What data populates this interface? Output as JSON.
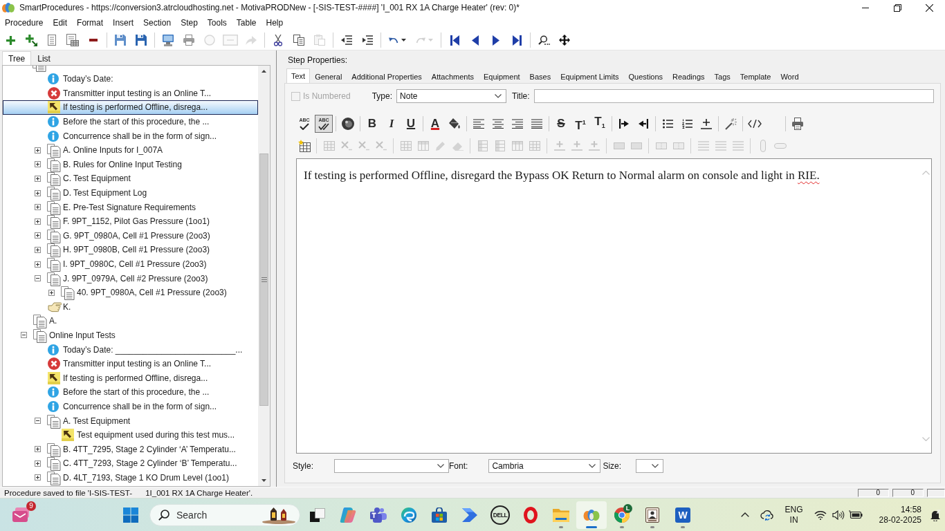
{
  "window": {
    "title": "SmartProcedures - https://conversion3.atrcloudhosting.net - MotivaPRODNew - [-SIS-TEST-####] 'I_001 RX 1A Charge Heater' (rev: 0)*"
  },
  "menu": [
    "Procedure",
    "Edit",
    "Format",
    "Insert",
    "Section",
    "Step",
    "Tools",
    "Table",
    "Help"
  ],
  "toolbar": [
    [
      {
        "kind": "add",
        "disabled": false
      },
      {
        "kind": "addchild",
        "disabled": false
      },
      {
        "kind": "list",
        "disabled": false
      },
      {
        "kind": "listtable",
        "disabled": false
      },
      {
        "kind": "remove",
        "disabled": false
      }
    ],
    [
      {
        "kind": "saveall",
        "disabled": false
      },
      {
        "kind": "save",
        "disabled": false
      }
    ],
    [
      {
        "kind": "publish",
        "disabled": false
      },
      {
        "kind": "print",
        "disabled": false
      },
      {
        "kind": "circle",
        "disabled": true
      },
      {
        "kind": "frame",
        "disabled": true
      },
      {
        "kind": "forward",
        "disabled": true
      }
    ],
    [
      {
        "kind": "cut",
        "disabled": false
      },
      {
        "kind": "copy",
        "disabled": false
      },
      {
        "kind": "paste",
        "disabled": true
      }
    ],
    [
      {
        "kind": "outdent",
        "disabled": false
      },
      {
        "kind": "indent",
        "disabled": false
      }
    ],
    [
      {
        "kind": "undo",
        "disabled": false
      },
      {
        "kind": "redo",
        "disabled": true
      }
    ],
    [
      {
        "kind": "first",
        "disabled": false
      },
      {
        "kind": "previous",
        "disabled": false
      },
      {
        "kind": "next",
        "disabled": false
      },
      {
        "kind": "last",
        "disabled": false
      }
    ],
    [
      {
        "kind": "find",
        "disabled": false
      },
      {
        "kind": "move",
        "disabled": false
      }
    ]
  ],
  "left_tabs": [
    {
      "label": "Tree",
      "selected": true
    },
    {
      "label": "List",
      "selected": false
    }
  ],
  "tree": [
    {
      "kind": "section",
      "selected": false,
      "children": [
        {
          "kind": "info",
          "label": "Today’s Date:",
          "selected": false
        },
        {
          "kind": "error",
          "label": "Transmitter input testing is an Online T...",
          "selected": false
        },
        {
          "kind": "note",
          "label": "If testing is performed Offline, disrega...",
          "selected": true
        },
        {
          "kind": "info",
          "label": "Before the start of this procedure, the ...",
          "selected": false
        },
        {
          "kind": "info",
          "label": "Concurrence shall be in the form of sign...",
          "selected": false
        },
        {
          "kind": "section",
          "label": "A. Online Inputs for I_007A",
          "expanded": false,
          "selected": false
        },
        {
          "kind": "section",
          "label": "B. Rules for Online Input Testing",
          "expanded": false,
          "selected": false
        },
        {
          "kind": "section",
          "label": "C. Test Equipment",
          "expanded": false,
          "selected": false
        },
        {
          "kind": "section",
          "label": "D. Test Equipment Log",
          "expanded": false,
          "selected": false
        },
        {
          "kind": "section",
          "label": "E. Pre-Test Signature Requirements",
          "expanded": false,
          "selected": false
        },
        {
          "kind": "section",
          "label": "F. 9PT_1152, Pilot Gas Pressure (1oo1)",
          "expanded": false,
          "selected": false
        },
        {
          "kind": "section",
          "label": "G. 9PT_0980A, Cell #1 Pressure (2oo3)",
          "expanded": false,
          "selected": false
        },
        {
          "kind": "section",
          "label": "H. 9PT_0980B, Cell #1 Pressure (2oo3)",
          "expanded": false,
          "selected": false
        },
        {
          "kind": "section",
          "label": "I. 9PT_0980C, Cell #1 Pressure (2oo3)",
          "expanded": false,
          "selected": false
        },
        {
          "kind": "section",
          "label": "J. 9PT_0979A, Cell #2 Pressure (2oo3)",
          "expanded": true,
          "selected": false,
          "children": [
            {
              "kind": "section",
              "label": "40. 9PT_0980A, Cell #1 Pressure (2oo3)",
              "expanded": false,
              "selected": false
            }
          ]
        },
        {
          "kind": "pointer",
          "label": "K.",
          "selected": false
        }
      ]
    },
    {
      "kind": "section",
      "label": "A.",
      "selected": false
    },
    {
      "kind": "section",
      "label": "Online Input Tests",
      "expanded": true,
      "selected": false,
      "children": [
        {
          "kind": "info",
          "label": "Today’s Date: __________________________...",
          "selected": false
        },
        {
          "kind": "error",
          "label": "Transmitter input testing is an Online T...",
          "selected": false
        },
        {
          "kind": "note",
          "label": "If testing is performed Offline, disrega...",
          "selected": false
        },
        {
          "kind": "info",
          "label": "Before the start of this procedure, the ...",
          "selected": false
        },
        {
          "kind": "info",
          "label": "Concurrence shall be in the form of sign...",
          "selected": false
        },
        {
          "kind": "section",
          "label": "A. Test Equipment",
          "expanded": true,
          "selected": false,
          "children": [
            {
              "kind": "note",
              "label": "Test equipment used during this test mus...",
              "selected": false
            }
          ]
        },
        {
          "kind": "section",
          "label": "B. 4TT_7295, Stage 2 Cylinder ‘A’ Temperatu...",
          "expanded": false,
          "selected": false
        },
        {
          "kind": "section",
          "label": "C. 4TT_7293, Stage 2 Cylinder ‘B’ Temperatu...",
          "expanded": false,
          "selected": false
        },
        {
          "kind": "section",
          "label": "D. 4LT_7193, Stage 1 KO Drum Level (1oo1)",
          "expanded": false,
          "selected": false
        }
      ]
    }
  ],
  "step_properties": {
    "heading": "Step Properties:",
    "tabs": [
      {
        "label": "Text",
        "selected": true
      },
      {
        "label": "General",
        "selected": false
      },
      {
        "label": "Additional Properties",
        "selected": false
      },
      {
        "label": "Attachments",
        "selected": false
      },
      {
        "label": "Equipment",
        "selected": false
      },
      {
        "label": "Bases",
        "selected": false
      },
      {
        "label": "Equipment Limits",
        "selected": false
      },
      {
        "label": "Questions",
        "selected": false
      },
      {
        "label": "Readings",
        "selected": false
      },
      {
        "label": "Tags",
        "selected": false
      },
      {
        "label": "Template",
        "selected": false
      },
      {
        "label": "Word",
        "selected": false
      }
    ],
    "is_numbered": {
      "label": "Is Numbered",
      "checked": false,
      "disabled": true
    },
    "type": {
      "label": "Type:",
      "value": "Note"
    },
    "title": {
      "label": "Title:"
    },
    "spellcheck": {
      "text": "ABC"
    },
    "auto_spellcheck": {
      "text": "ABC",
      "on": true
    },
    "format_toolbar": [
      [
        {
          "kind": "media"
        }
      ],
      [
        {
          "kind": "bold",
          "text": "B"
        },
        {
          "kind": "italic",
          "text": "I"
        },
        {
          "kind": "underline",
          "text": "U"
        }
      ],
      [
        {
          "kind": "fontcolor",
          "text": "A"
        },
        {
          "kind": "fill"
        }
      ],
      [
        {
          "kind": "alignleft"
        },
        {
          "kind": "aligncenter"
        },
        {
          "kind": "alignright"
        },
        {
          "kind": "justify"
        }
      ],
      [
        {
          "kind": "strike",
          "text": "S"
        },
        {
          "kind": "superscript",
          "text": "T$^{1}$"
        },
        {
          "kind": "subscript",
          "text": "T$_{1}$"
        }
      ],
      [
        {
          "kind": "indent"
        },
        {
          "kind": "outdent"
        }
      ],
      [
        {
          "kind": "bullets"
        },
        {
          "kind": "numbering"
        },
        {
          "kind": "rule"
        }
      ],
      [
        {
          "kind": "wand"
        }
      ],
      [
        {
          "kind": "code"
        }
      ],
      [
        {
          "kind": "print"
        }
      ]
    ],
    "table_toolbar": [
      [
        {
          "kind": "tablestar",
          "disabled": false
        }
      ],
      [
        {
          "kind": "grid",
          "disabled": true
        },
        {
          "kind": "cross",
          "disabled": true
        },
        {
          "kind": "cross",
          "disabled": true
        },
        {
          "kind": "cross",
          "disabled": true
        }
      ],
      [
        {
          "kind": "grid",
          "disabled": true
        },
        {
          "kind": "row",
          "disabled": true
        },
        {
          "kind": "pencil",
          "disabled": true
        },
        {
          "kind": "eraser",
          "disabled": true
        }
      ],
      [
        {
          "kind": "column",
          "disabled": true
        },
        {
          "kind": "column",
          "disabled": true
        },
        {
          "kind": "row",
          "disabled": true
        },
        {
          "kind": "grid",
          "disabled": true
        }
      ],
      [
        {
          "kind": "insert",
          "disabled": true
        },
        {
          "kind": "insert",
          "disabled": true
        },
        {
          "kind": "insert",
          "disabled": true
        }
      ],
      [
        {
          "kind": "cells",
          "disabled": true
        },
        {
          "kind": "cells",
          "disabled": true
        }
      ],
      [
        {
          "kind": "split",
          "disabled": true
        },
        {
          "kind": "split",
          "disabled": true
        }
      ],
      [
        {
          "kind": "lines",
          "disabled": true
        },
        {
          "kind": "lines",
          "disabled": true
        },
        {
          "kind": "lines",
          "disabled": true
        }
      ],
      [
        {
          "kind": "cylinder",
          "disabled": true
        },
        {
          "kind": "pill",
          "disabled": true
        }
      ]
    ],
    "text": [
      {
        "text": "If testing is performed Offline, disregard the Bypass OK Return to Normal alarm on console and light in ",
        "misspelled": false
      },
      {
        "text": "RIE.",
        "misspelled": true
      }
    ],
    "style": {
      "label": "Style:"
    },
    "font": {
      "label": "Font:",
      "value": "Cambria"
    },
    "size": {
      "label": "Size:"
    }
  },
  "status_bar": {
    "message": "Procedure saved to file 'I-SIS-TEST-      1I_001 RX 1A Charge Heater'.",
    "panels": [
      "0",
      "0"
    ]
  },
  "taskbar": {
    "widget": {
      "badge": "9"
    },
    "search": {
      "placeholder": "Search"
    },
    "apps": [
      {
        "kind": "taskview",
        "running": false,
        "active": false
      },
      {
        "kind": "copilot",
        "running": false,
        "active": false
      },
      {
        "kind": "teams",
        "running": false,
        "active": false
      },
      {
        "kind": "edge",
        "running": false,
        "active": false
      },
      {
        "kind": "store",
        "running": false,
        "active": false
      },
      {
        "kind": "automate",
        "running": false,
        "active": false
      },
      {
        "kind": "dell",
        "text": "DELL",
        "running": false,
        "active": false
      },
      {
        "kind": "opera",
        "running": false,
        "active": false
      },
      {
        "kind": "folder",
        "running": true,
        "active": false
      },
      {
        "kind": "smart",
        "running": true,
        "active": true
      },
      {
        "kind": "chrome",
        "badge": "L",
        "running": true,
        "active": false
      },
      {
        "kind": "portrait",
        "running": true,
        "active": false
      },
      {
        "kind": "word",
        "text": "W",
        "running": true,
        "active": false
      }
    ],
    "language": "ENG",
    "region": "IN",
    "time": "14:58",
    "date": "28-02-2025"
  }
}
